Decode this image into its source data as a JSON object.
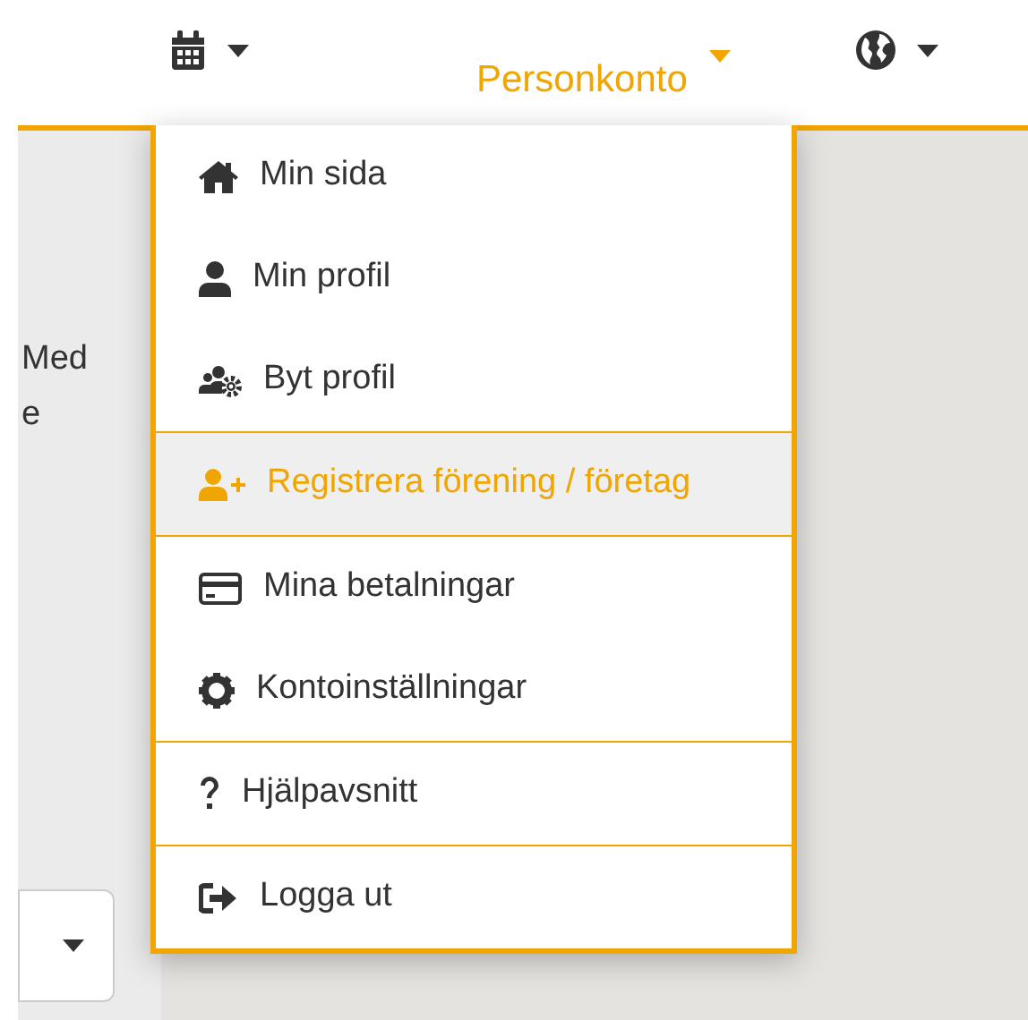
{
  "nav": [
    {
      "kind": "icon",
      "active": false
    },
    {
      "kind": "text",
      "label": "Personkonto",
      "active": true
    },
    {
      "kind": "icon",
      "active": false
    }
  ],
  "background_text": [
    "Med",
    "e"
  ],
  "menu": {
    "sections": [
      [
        {
          "label": "Min sida",
          "selected": false
        },
        {
          "label": "Min profil",
          "selected": false
        },
        {
          "label": "Byt profil",
          "selected": false
        }
      ],
      [
        {
          "label": "Registrera förening / företag",
          "selected": true
        }
      ],
      [
        {
          "label": "Mina betalningar",
          "selected": false
        },
        {
          "label": "Kontoinställningar",
          "selected": false
        }
      ],
      [
        {
          "label": "Hjälpavsnitt",
          "selected": false
        }
      ],
      [
        {
          "label": "Logga ut",
          "selected": false
        }
      ]
    ]
  }
}
